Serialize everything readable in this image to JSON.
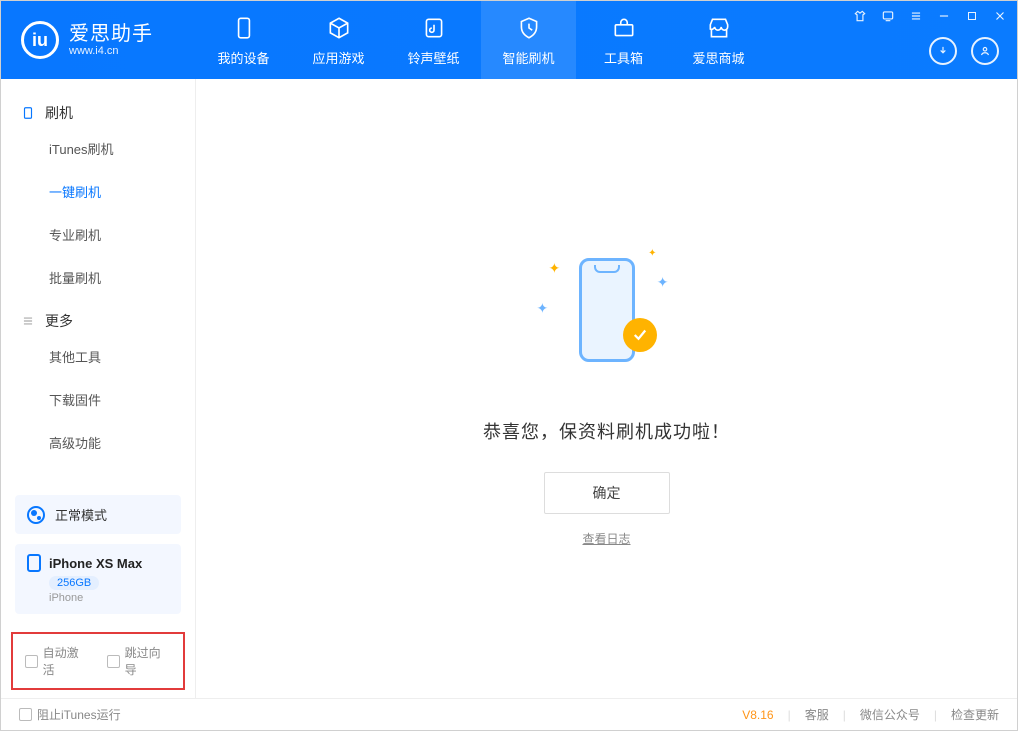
{
  "header": {
    "logo_title": "爱思助手",
    "logo_sub": "www.i4.cn",
    "tabs": [
      {
        "label": "我的设备"
      },
      {
        "label": "应用游戏"
      },
      {
        "label": "铃声壁纸"
      },
      {
        "label": "智能刷机"
      },
      {
        "label": "工具箱"
      },
      {
        "label": "爱思商城"
      }
    ]
  },
  "sidebar": {
    "group1": "刷机",
    "items1": [
      "iTunes刷机",
      "一键刷机",
      "专业刷机",
      "批量刷机"
    ],
    "group2": "更多",
    "items2": [
      "其他工具",
      "下载固件",
      "高级功能"
    ],
    "mode_label": "正常模式",
    "device_name": "iPhone XS Max",
    "device_storage": "256GB",
    "device_type": "iPhone",
    "opt_auto_activate": "自动激活",
    "opt_skip_guide": "跳过向导"
  },
  "main": {
    "success_msg": "恭喜您，保资料刷机成功啦！",
    "ok_button": "确定",
    "log_link": "查看日志"
  },
  "statusbar": {
    "block_itunes": "阻止iTunes运行",
    "version": "V8.16",
    "links": [
      "客服",
      "微信公众号",
      "检查更新"
    ]
  }
}
